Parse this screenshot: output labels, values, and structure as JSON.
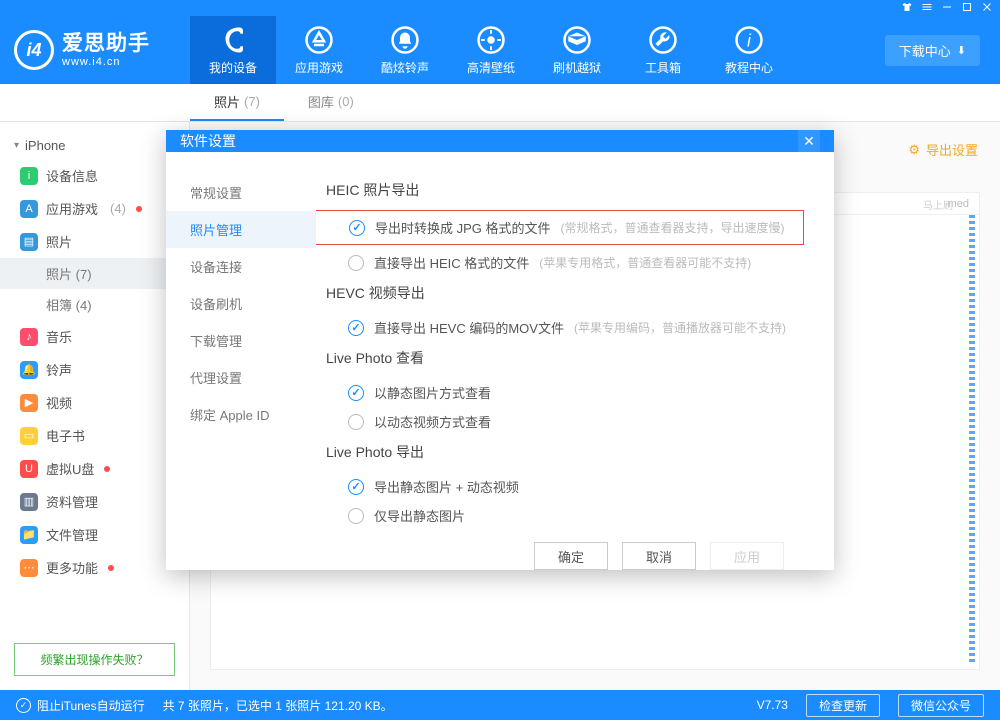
{
  "brand": {
    "name": "爱思助手",
    "url": "www.i4.cn",
    "logo": "i4"
  },
  "titlebar_download_center": "下载中心",
  "nav": [
    {
      "label": "我的设备"
    },
    {
      "label": "应用游戏"
    },
    {
      "label": "酷炫铃声"
    },
    {
      "label": "高清壁纸"
    },
    {
      "label": "刷机越狱"
    },
    {
      "label": "工具箱"
    },
    {
      "label": "教程中心"
    }
  ],
  "subtabs": {
    "photos_label": "照片",
    "photos_count": "(7)",
    "library_label": "图库",
    "library_count": "(0)"
  },
  "sidebar": {
    "device": "iPhone",
    "items": {
      "info": {
        "label": "设备信息"
      },
      "apps": {
        "label": "应用游戏",
        "aux": "(4)"
      },
      "photos": {
        "label": "照片"
      },
      "photos_sub1": {
        "label": "照片",
        "count": "(7)"
      },
      "photos_sub2": {
        "label": "相簿",
        "count": "(4)"
      },
      "music": {
        "label": "音乐"
      },
      "ring": {
        "label": "铃声"
      },
      "video": {
        "label": "视频"
      },
      "ebook": {
        "label": "电子书"
      },
      "vdisk": {
        "label": "虚拟U盘"
      },
      "data": {
        "label": "资料管理"
      },
      "file": {
        "label": "文件管理"
      },
      "more": {
        "label": "更多功能"
      }
    },
    "faq": "频繁出现操作失败？"
  },
  "content": {
    "export_settings": "导出设置",
    "bg_col": "med",
    "bg_time": "马上刷"
  },
  "modal": {
    "title": "软件设置",
    "side": [
      "常规设置",
      "照片管理",
      "设备连接",
      "设备刷机",
      "下载管理",
      "代理设置",
      "绑定 Apple ID"
    ],
    "sections": {
      "heic_title": "HEIC 照片导出",
      "heic_opt1": "导出时转换成 JPG 格式的文件",
      "heic_opt1_hint": "(常规格式，普通查看器支持，导出速度慢)",
      "heic_opt2": "直接导出 HEIC 格式的文件",
      "heic_opt2_hint": "(苹果专用格式，普通查看器可能不支持)",
      "hevc_title": "HEVC 视频导出",
      "hevc_opt1": "直接导出 HEVC 编码的MOV文件",
      "hevc_opt1_hint": "(苹果专用编码，普通播放器可能不支持)",
      "lp_view_title": "Live Photo 查看",
      "lp_view_opt1": "以静态图片方式查看",
      "lp_view_opt2": "以动态视频方式查看",
      "lp_exp_title": "Live Photo 导出",
      "lp_exp_opt1": "导出静态图片 + 动态视频",
      "lp_exp_opt2": "仅导出静态图片"
    },
    "buttons": {
      "ok": "确定",
      "cancel": "取消",
      "apply": "应用"
    }
  },
  "status": {
    "itunes": "阻止iTunes自动运行",
    "summary": "共 7 张照片，已选中 1 张照片 121.20 KB。",
    "version": "V7.73",
    "check_update": "检查更新",
    "wechat": "微信公众号"
  }
}
